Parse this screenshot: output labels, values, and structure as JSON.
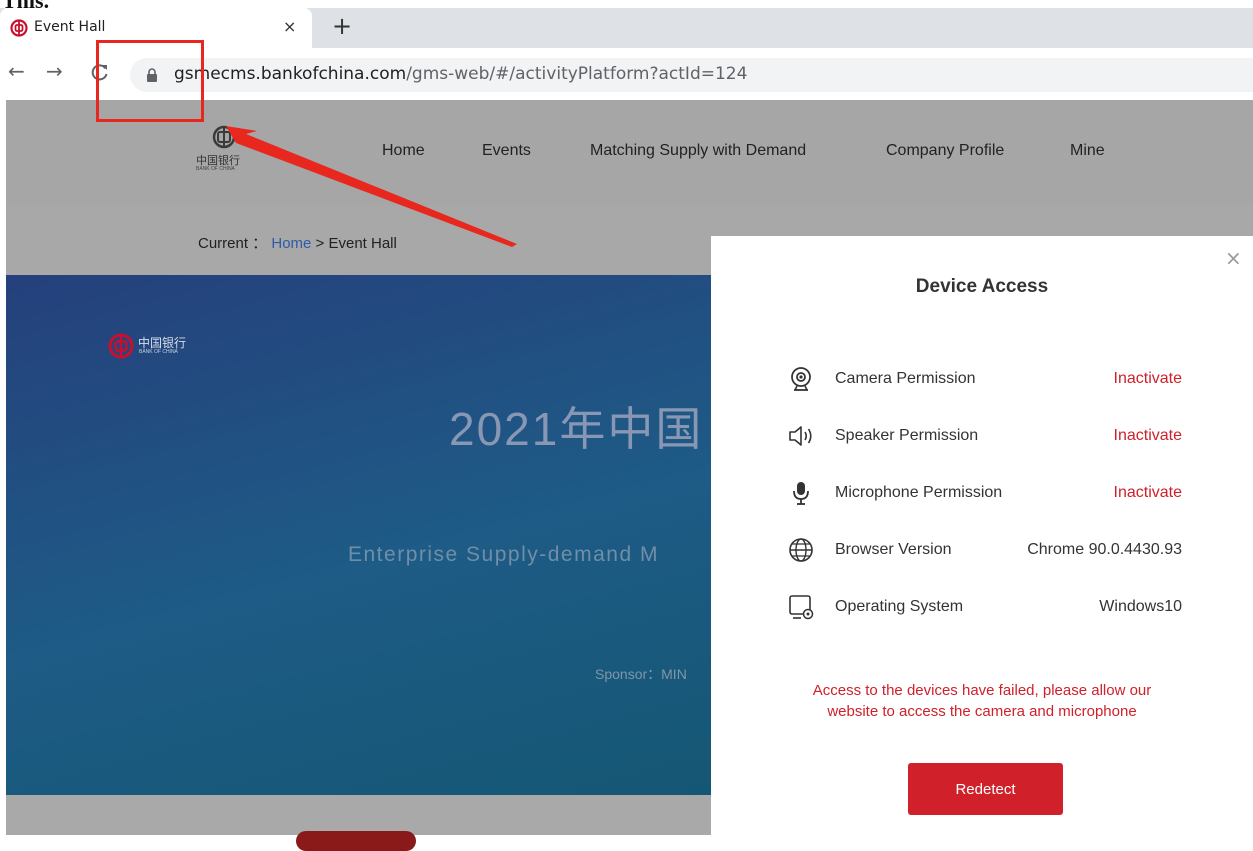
{
  "doc_top_text": "This.",
  "browser": {
    "tab_title": "Event Hall",
    "tab_close": "×",
    "new_tab": "+",
    "back": "←",
    "forward": "→",
    "url_domain": "gsmecms.bankofchina.com",
    "url_path": "/gms-web/#/activityPlatform?actId=124"
  },
  "header": {
    "logo_text": "中国银行",
    "logo_sub": "BANK OF CHINA",
    "nav": [
      "Home",
      "Events",
      "Matching Supply with Demand",
      "Company Profile",
      "Mine"
    ]
  },
  "breadcrumb": {
    "prefix": "Current ：",
    "home": "Home",
    "separator": ">",
    "current": "Event Hall"
  },
  "banner": {
    "logo_text": "中国银行",
    "logo_sub": "BANK OF CHINA",
    "title": "2021年中国",
    "subtitle": "Enterprise Supply-demand M",
    "sponsor": "Sponsor：MIN"
  },
  "modal": {
    "close": "×",
    "title": "Device Access",
    "rows": [
      {
        "label": "Camera Permission",
        "value": "Inactivate",
        "icon": "camera-icon"
      },
      {
        "label": "Speaker Permission",
        "value": "Inactivate",
        "icon": "speaker-icon"
      },
      {
        "label": "Microphone Permission",
        "value": "Inactivate",
        "icon": "microphone-icon"
      },
      {
        "label": "Browser Version",
        "value": "Chrome 90.0.4430.93",
        "icon": "globe-icon"
      },
      {
        "label": "Operating System",
        "value": "Windows10",
        "icon": "monitor-icon"
      }
    ],
    "error_line1": "Access to the devices have failed, please allow our",
    "error_line2": "website to access the camera and microphone",
    "button": "Redetect"
  },
  "colors": {
    "brand_red": "#d0202a",
    "annotation_red": "#e8281e",
    "link_blue": "#2f5aa8"
  }
}
